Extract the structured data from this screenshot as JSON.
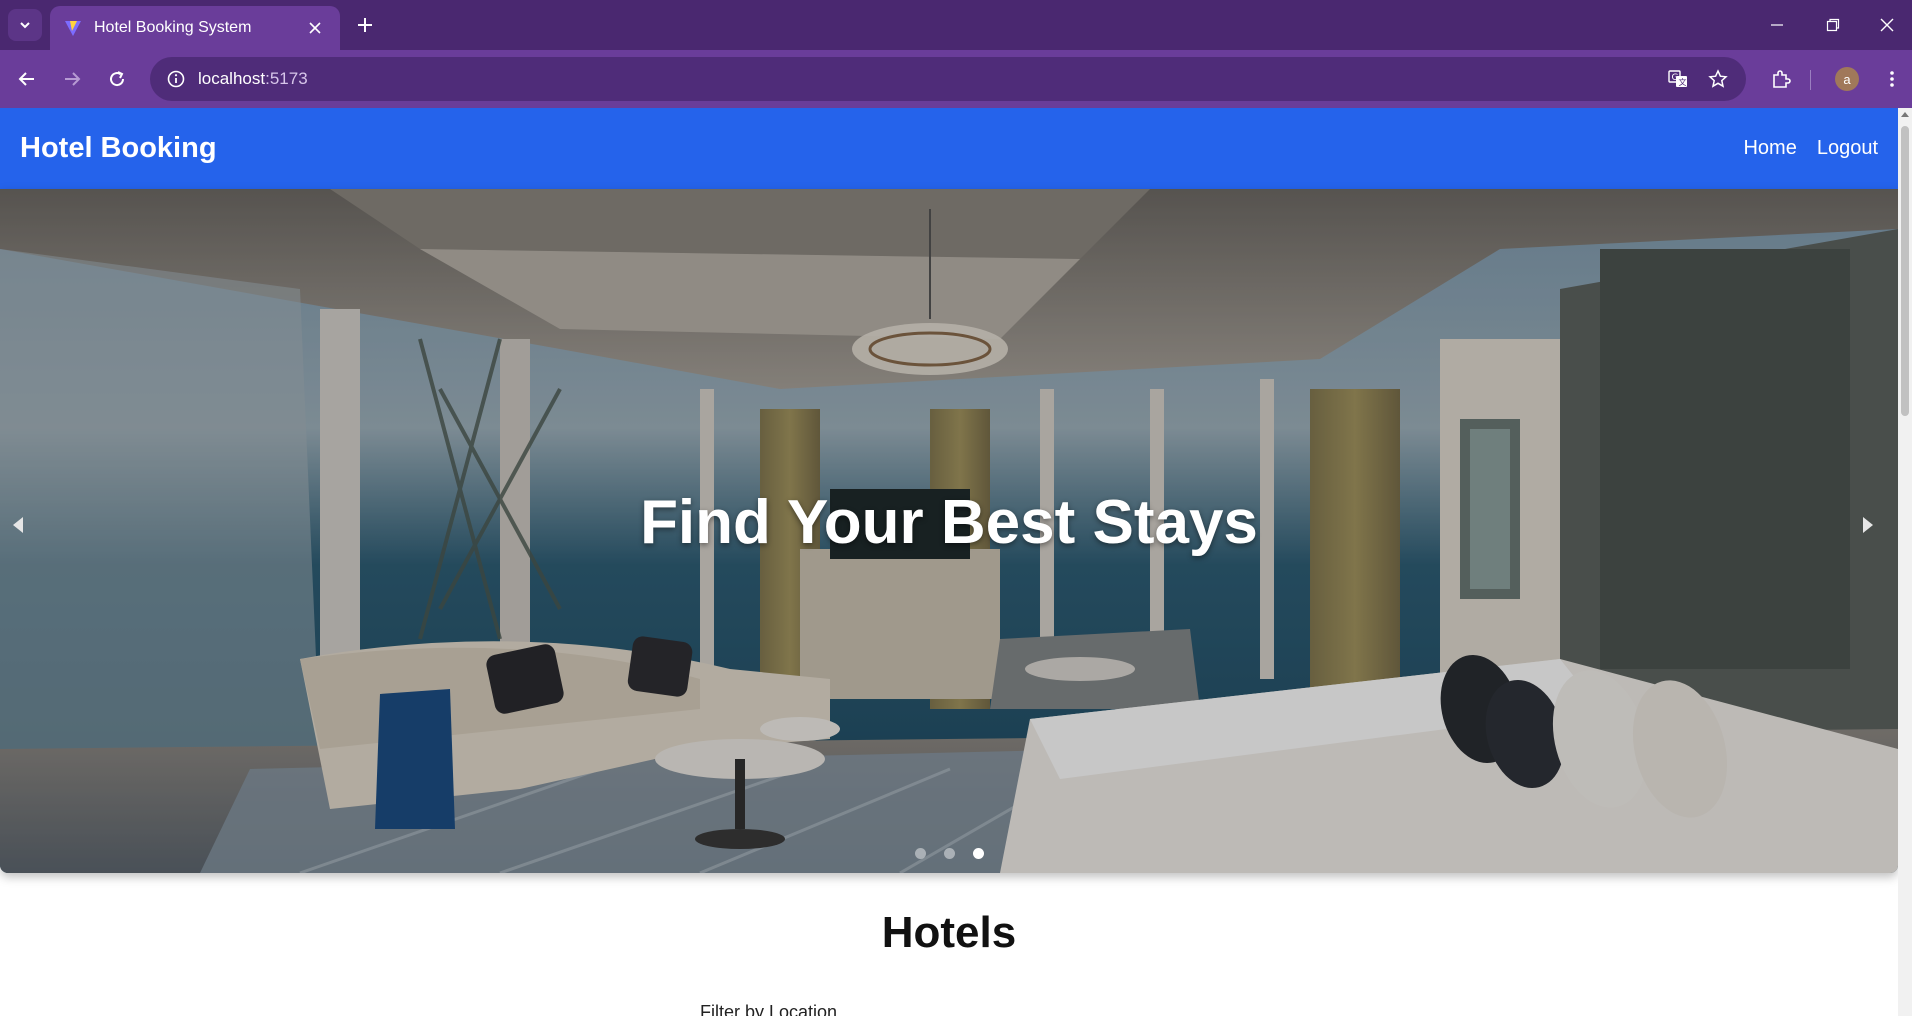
{
  "browser": {
    "tab_title": "Hotel Booking System",
    "url_host": "localhost",
    "url_port": ":5173"
  },
  "app": {
    "brand": "Hotel Booking",
    "nav": [
      {
        "label": "Home"
      },
      {
        "label": "Logout"
      }
    ]
  },
  "hero": {
    "title": "Find Your Best Stays",
    "slides_total": 3,
    "active_slide": 3
  },
  "hotels": {
    "section_title": "Hotels",
    "filter_label": "Filter by Location"
  },
  "profile": {
    "initial": "a"
  },
  "colors": {
    "app_nav": "#2563eb",
    "browser_frame": "#6a3d9a"
  }
}
